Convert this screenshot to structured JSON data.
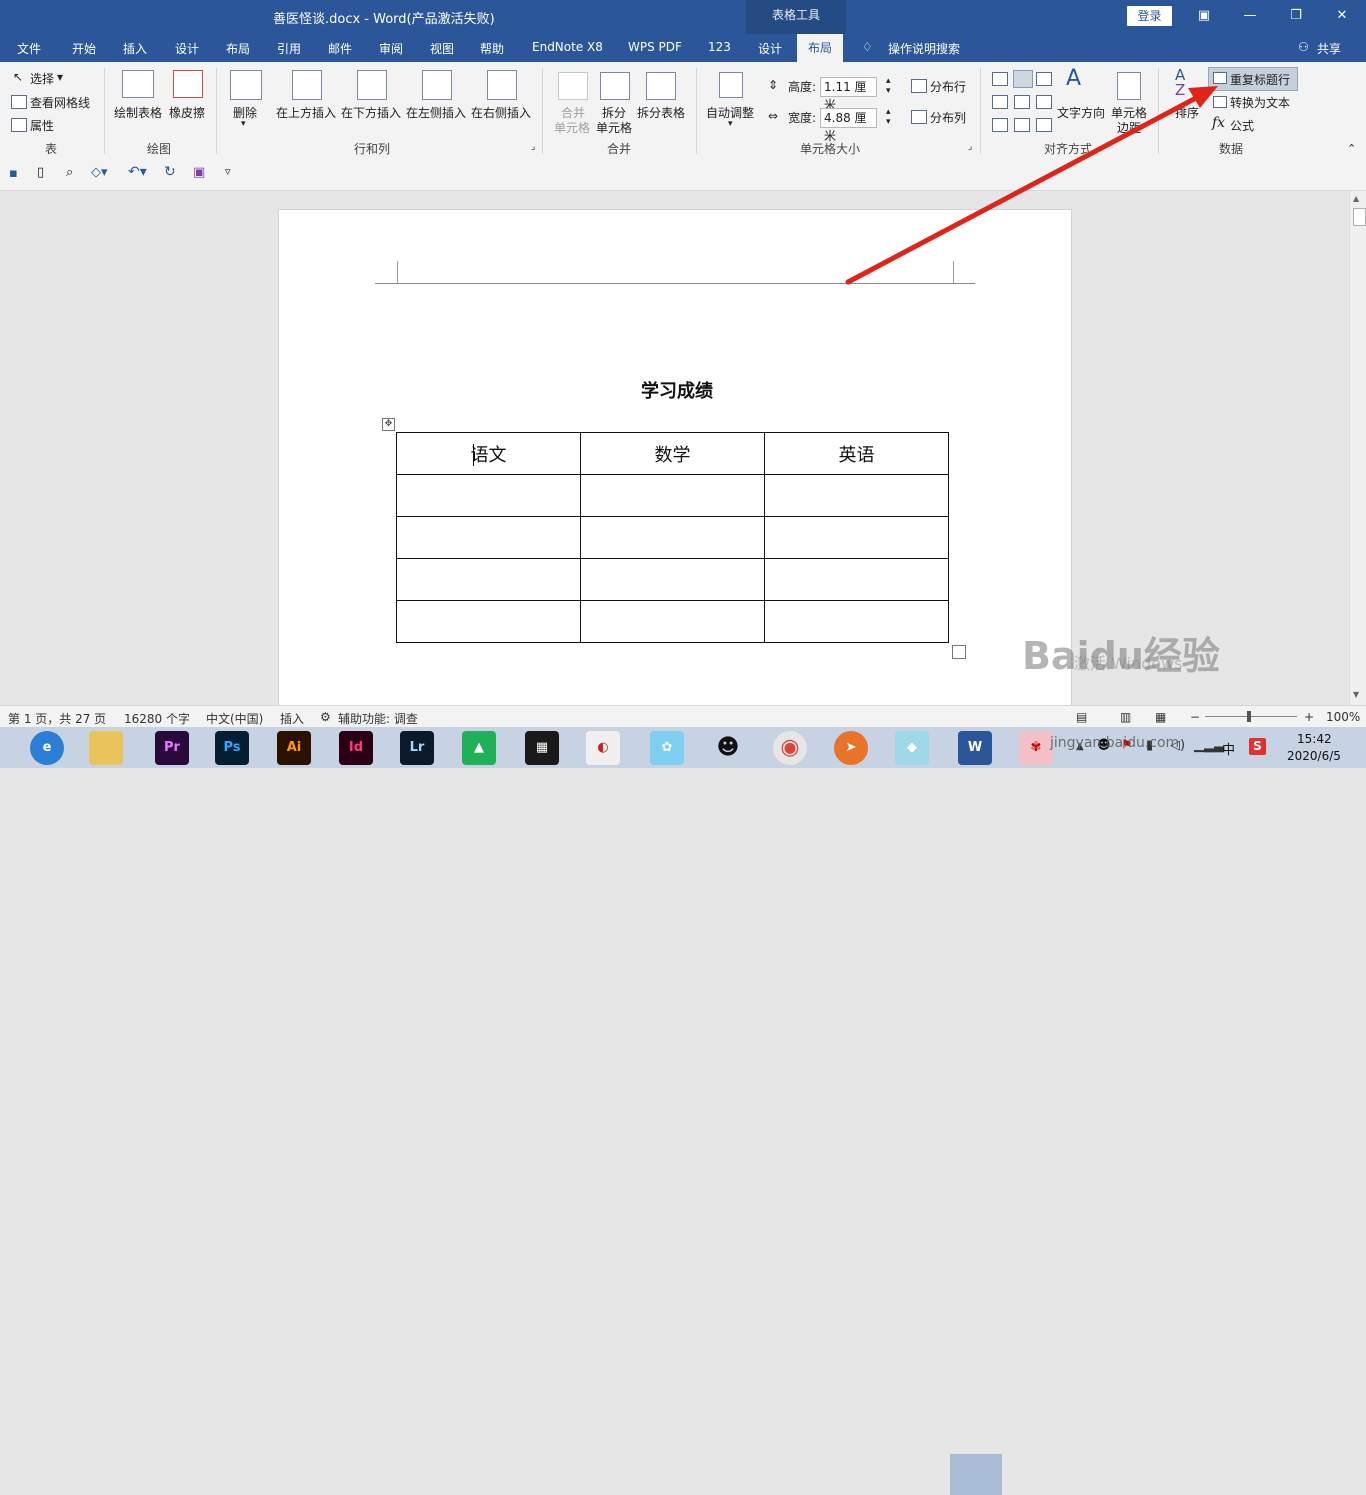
{
  "window": {
    "title": "善医怪谈.docx  -  Word(产品激活失败)",
    "context_tab": "表格工具",
    "login_label": "登录",
    "colors": {
      "brand": "#2b579a",
      "ribbon_bg": "#f3f3f3",
      "arrow": "#e0241a"
    }
  },
  "tabs": [
    "文件",
    "开始",
    "插入",
    "设计",
    "布局",
    "引用",
    "邮件",
    "审阅",
    "视图",
    "帮助",
    "EndNote X8",
    "WPS PDF",
    "123",
    "设计",
    "布局"
  ],
  "active_tab": "布局",
  "tell_me": "操作说明搜索",
  "share": "共享",
  "ribbon": {
    "table_group": {
      "select": "选择",
      "view_gridlines": "查看网格线",
      "properties": "属性",
      "label": "表"
    },
    "draw_group": {
      "draw_table": "绘制表格",
      "eraser": "橡皮擦",
      "label": "绘图"
    },
    "rows_cols_group": {
      "delete": "删除",
      "insert_above": "在上方插入",
      "insert_below": "在下方插入",
      "insert_left": "在左侧插入",
      "insert_right": "在右侧插入",
      "label": "行和列"
    },
    "merge_group": {
      "merge_cells_1": "合并",
      "merge_cells_2": "单元格",
      "split_cells_1": "拆分",
      "split_cells_2": "单元格",
      "split_table": "拆分表格",
      "label": "合并"
    },
    "cell_size_group": {
      "autofit": "自动调整",
      "height_label": "高度:",
      "height_value": "1.11 厘米",
      "width_label": "宽度:",
      "width_value": "4.88 厘米",
      "distribute_rows": "分布行",
      "distribute_cols": "分布列",
      "label": "单元格大小"
    },
    "align_group": {
      "text_direction": "文字方向",
      "cell_margins_1": "单元格",
      "cell_margins_2": "边距",
      "label": "对齐方式"
    },
    "data_group": {
      "sort": "排序",
      "repeat_header": "重复标题行",
      "convert_text": "转换为文本",
      "formula": "公式",
      "label": "数据"
    }
  },
  "document": {
    "heading": "学习成绩",
    "table": {
      "headers": [
        "语文",
        "数学",
        "英语"
      ],
      "rows": [
        [
          "",
          "",
          ""
        ],
        [
          "",
          "",
          ""
        ],
        [
          "",
          "",
          ""
        ],
        [
          "",
          "",
          ""
        ]
      ]
    }
  },
  "status": {
    "page": "第 1 页，共 27 页",
    "words": "16280 个字",
    "language": "中文(中国)",
    "mode": "插入",
    "accessibility": "辅助功能: 调查",
    "zoom": "100%"
  },
  "watermark": {
    "main": "Baidu经验",
    "url": "jingyan.baidu.com",
    "activate": "激活 Windows"
  },
  "taskbar": {
    "apps": [
      "Pr",
      "Ps",
      "Ai",
      "Id",
      "Lr"
    ],
    "ime": "中",
    "time": "15:42",
    "date": "2020/6/5"
  }
}
